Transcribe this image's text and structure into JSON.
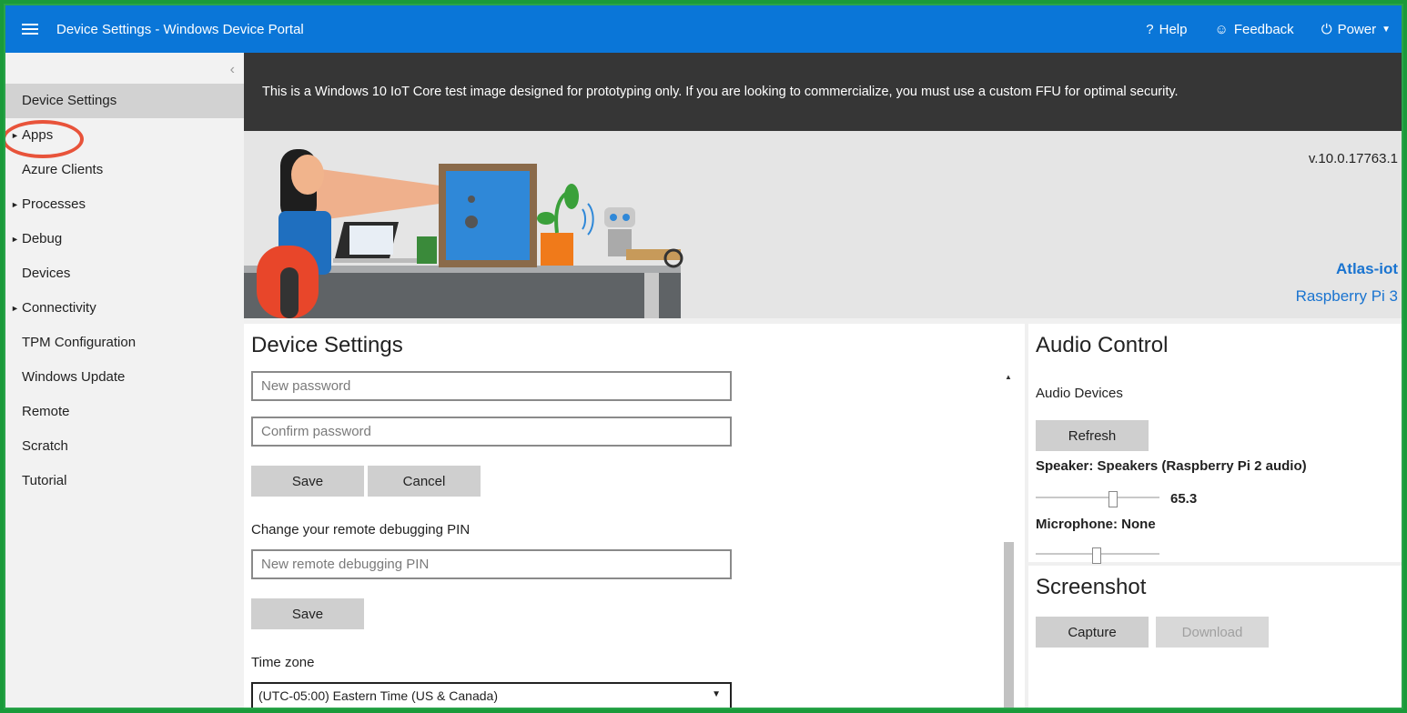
{
  "topbar": {
    "title": "Device Settings - Windows Device Portal",
    "help": "Help",
    "feedback": "Feedback",
    "power": "Power"
  },
  "sidebar": {
    "items": [
      {
        "label": "Device Settings",
        "expandable": false,
        "active": true
      },
      {
        "label": "Apps",
        "expandable": true
      },
      {
        "label": "Azure Clients",
        "expandable": false
      },
      {
        "label": "Processes",
        "expandable": true
      },
      {
        "label": "Debug",
        "expandable": true
      },
      {
        "label": "Devices",
        "expandable": false
      },
      {
        "label": "Connectivity",
        "expandable": true
      },
      {
        "label": "TPM Configuration",
        "expandable": false
      },
      {
        "label": "Windows Update",
        "expandable": false
      },
      {
        "label": "Remote",
        "expandable": false
      },
      {
        "label": "Scratch",
        "expandable": false
      },
      {
        "label": "Tutorial",
        "expandable": false
      }
    ]
  },
  "notice": "This is a Windows 10 IoT Core test image designed for prototyping only. If you are looking to commercialize, you must use a custom FFU for optimal security.",
  "hero": {
    "version": "v.10.0.17763.1",
    "device_name": "Atlas-iot",
    "device_model": "Raspberry Pi 3"
  },
  "device_settings": {
    "title": "Device Settings",
    "new_password_placeholder": "New password",
    "confirm_password_placeholder": "Confirm password",
    "save_label": "Save",
    "cancel_label": "Cancel",
    "pin_heading": "Change your remote debugging PIN",
    "pin_placeholder": "New remote debugging PIN",
    "pin_save_label": "Save",
    "timezone_label": "Time zone",
    "timezone_value": "(UTC-05:00) Eastern Time (US & Canada)"
  },
  "audio": {
    "title": "Audio Control",
    "devices_label": "Audio Devices",
    "refresh_label": "Refresh",
    "speaker_label": "Speaker: Speakers (Raspberry Pi 2 audio)",
    "speaker_volume": "65.3",
    "microphone_label": "Microphone: None"
  },
  "screenshot": {
    "title": "Screenshot",
    "capture_label": "Capture",
    "download_label": "Download"
  },
  "colors": {
    "accent": "#0a76d8",
    "annotation": "#e8533a",
    "device_name": "#1a74d0"
  }
}
